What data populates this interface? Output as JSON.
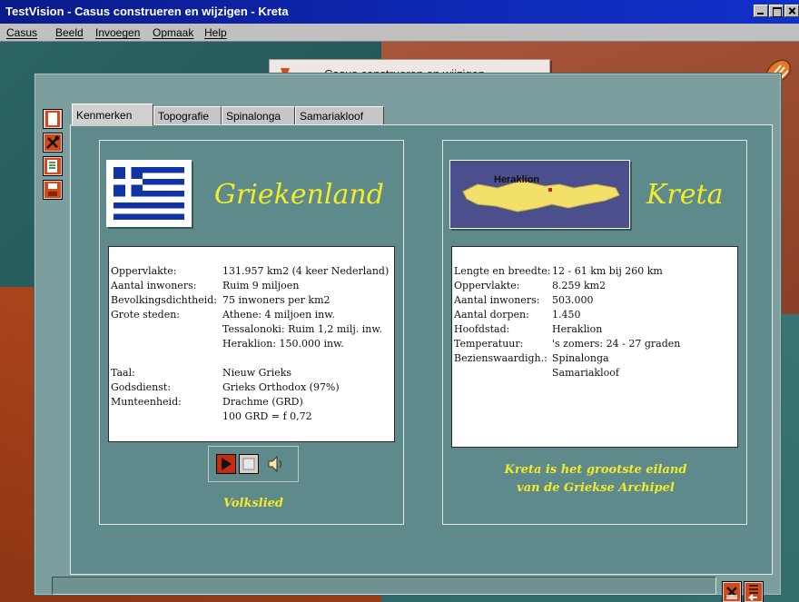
{
  "window": {
    "title": "TestVision - Casus construeren en wijzigen - Kreta"
  },
  "menu": {
    "items": [
      {
        "label": "Casus"
      },
      {
        "label": "Beeld"
      },
      {
        "label": "Invoegen"
      },
      {
        "label": "Opmaak"
      },
      {
        "label": "Help"
      }
    ]
  },
  "caption": {
    "text": "Casus construeren en wijzigen"
  },
  "tabs": [
    {
      "label": "Kenmerken",
      "active": true
    },
    {
      "label": "Topografie",
      "active": false
    },
    {
      "label": "Spinalonga",
      "active": false
    },
    {
      "label": "Samariakloof",
      "active": false
    }
  ],
  "left_card": {
    "title": "Griekenland",
    "rows": [
      {
        "label": "Oppervlakte:",
        "value": "131.957 km2 (4 keer Nederland)"
      },
      {
        "label": "Aantal inwoners:",
        "value": "Ruim 9 miljoen"
      },
      {
        "label": "Bevolkingsdichtheid:",
        "value": "75 inwoners per km2"
      },
      {
        "label": "Grote steden:",
        "value": "Athene: 4 miljoen inw."
      },
      {
        "label": "",
        "value": "Tessalonoki: Ruim 1,2 milj. inw."
      },
      {
        "label": "",
        "value": "Heraklion: 150.000 inw."
      },
      {
        "label": "Taal:",
        "value": "Nieuw Grieks"
      },
      {
        "label": "Godsdienst:",
        "value": "Grieks Orthodox (97%)"
      },
      {
        "label": "Munteenheid:",
        "value": "Drachme (GRD)"
      },
      {
        "label": "",
        "value": "100 GRD = f 0,72"
      }
    ],
    "player_caption": "Volkslied"
  },
  "right_card": {
    "title": "Kreta",
    "map_label": "Heraklion",
    "rows": [
      {
        "label": "Lengte en breedte:",
        "value": "12 - 61 km bij 260 km"
      },
      {
        "label": "Oppervlakte:",
        "value": "8.259 km2"
      },
      {
        "label": "Aantal inwoners:",
        "value": "503.000"
      },
      {
        "label": "Aantal dorpen:",
        "value": "1.450"
      },
      {
        "label": "Hoofdstad:",
        "value": "Heraklion"
      },
      {
        "label": "Temperatuur:",
        "value": "'s zomers: 24 - 27 graden"
      },
      {
        "label": "Bezienswaardigh.:",
        "value": "Spinalonga"
      },
      {
        "label": "",
        "value": "Samariakloof"
      }
    ],
    "caption_line1": "Kreta is het grootste eiland",
    "caption_line2": "van de Griekse Archipel"
  },
  "colors": {
    "title_bar": "#0f2ab8",
    "panel": "#7d9e9f",
    "content": "#5e8a8c",
    "accent_yellow": "#f2eb2a",
    "greek_blue": "#1034a6"
  },
  "icons": [
    "new-page-icon",
    "tools-icon",
    "list-edit-icon",
    "save-icon",
    "corner-badge-icon",
    "play-icon",
    "stop-icon",
    "speaker-icon",
    "settings-icon",
    "exit-icon"
  ]
}
